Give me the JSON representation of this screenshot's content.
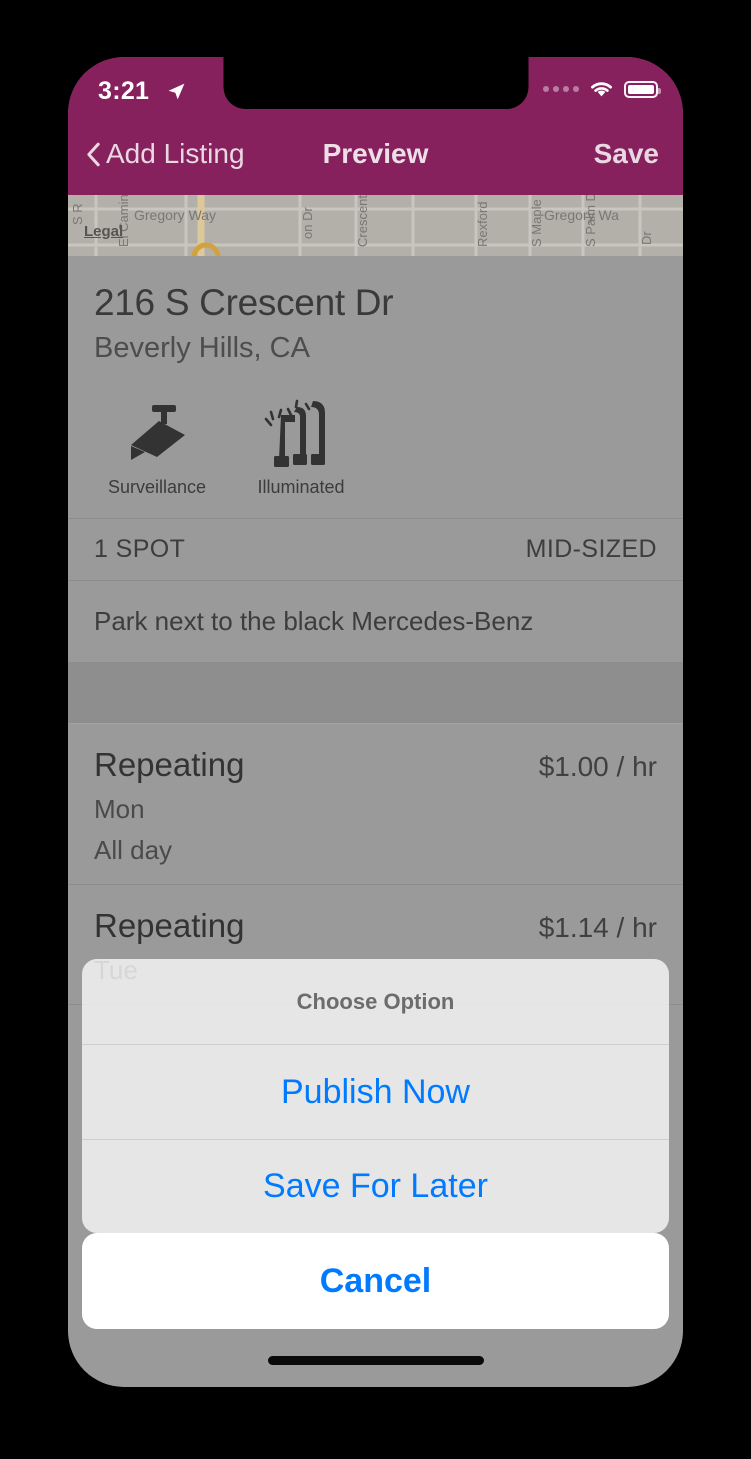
{
  "status_bar": {
    "time": "3:21",
    "location_icon": "location-arrow-icon",
    "wifi_icon": "wifi-icon",
    "battery_icon": "battery-icon",
    "signal_icon": "signal-dots-icon"
  },
  "nav": {
    "back_label": "Add Listing",
    "back_icon": "chevron-left-icon",
    "title": "Preview",
    "save_label": "Save",
    "bar_color": "#86215d"
  },
  "map": {
    "legal_label": "Legal",
    "street_labels": [
      "S R",
      "El Camin",
      "Gregory Way",
      "on Dr",
      "Crescent",
      "Rexford",
      "S Maple D",
      "S Palm D",
      "Gregory Wa",
      "Dr"
    ]
  },
  "listing": {
    "address_line1": "216 S Crescent Dr",
    "address_line2": "Beverly Hills, CA",
    "amenities": [
      {
        "label": "Surveillance",
        "icon": "security-camera-icon"
      },
      {
        "label": "Illuminated",
        "icon": "street-lamps-icon"
      }
    ],
    "spot_count": "1 SPOT",
    "vehicle_size": "MID-SIZED",
    "notes": "Park next to the black Mercedes-Benz"
  },
  "schedules": [
    {
      "title": "Repeating",
      "price": "$1.00 / hr",
      "day": "Mon",
      "hours": "All day"
    },
    {
      "title": "Repeating",
      "price": "$1.14 / hr",
      "day": "Tue",
      "hours": ""
    }
  ],
  "action_sheet": {
    "header": "Choose Option",
    "options": [
      {
        "label": "Publish Now"
      },
      {
        "label": "Save For Later"
      }
    ],
    "cancel_label": "Cancel",
    "tint_color": "#007aff"
  }
}
